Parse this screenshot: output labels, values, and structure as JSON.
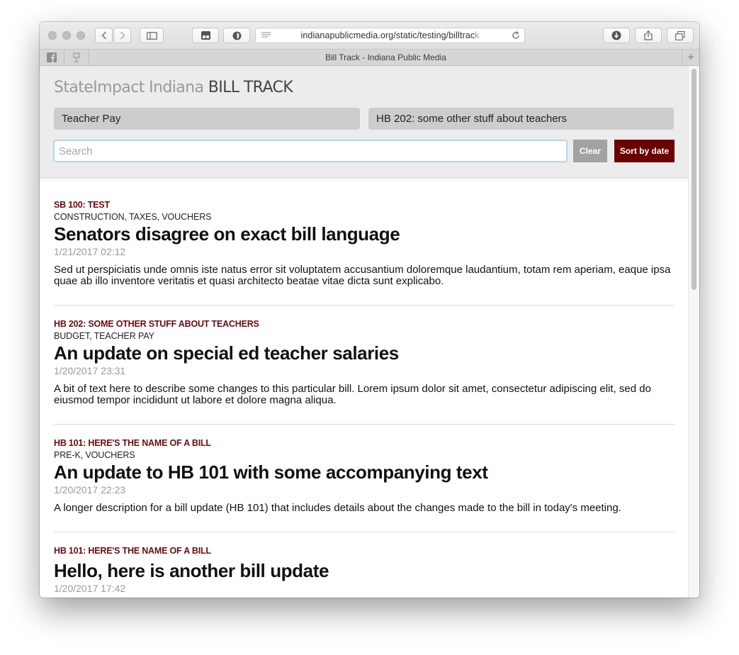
{
  "browser": {
    "url_main": "indianapublicmedia.org/static/testing/billtrac",
    "url_fade": "k",
    "tab_title": "Bill Track - Indiana Public Media",
    "new_tab_symbol": "+"
  },
  "header": {
    "brand_prefix": "StateImpact Indiana",
    "brand_suffix": "BILL TRACK",
    "filter_topic": "Teacher Pay",
    "filter_bill": "HB 202: some other stuff about teachers",
    "search_placeholder": "Search",
    "clear_label": "Clear",
    "sort_label": "Sort by date"
  },
  "entries": [
    {
      "bill": "SB 100: test",
      "tags": "Construction, Taxes, Vouchers",
      "title": "Senators disagree on exact bill language",
      "date": "1/21/2017 02:12",
      "desc": "Sed ut perspiciatis unde omnis iste natus error sit voluptatem accusantium doloremque laudantium, totam rem aperiam, eaque ipsa quae ab illo inventore veritatis et quasi architecto beatae vitae dicta sunt explicabo."
    },
    {
      "bill": "HB 202: some other stuff about teachers",
      "tags": "Budget, Teacher Pay",
      "title": "An update on special ed teacher salaries",
      "date": "1/20/2017 23:31",
      "desc": "A bit of text here to describe some changes to this particular bill. Lorem ipsum dolor sit amet, consectetur adipiscing elit, sed do eiusmod tempor incididunt ut labore et dolore magna aliqua."
    },
    {
      "bill": "HB 101: Here's the name of a bill",
      "tags": "Pre-K, Vouchers",
      "title": "An update to HB 101 with some accompanying text",
      "date": "1/20/2017 22:23",
      "desc": "A longer description for a bill update (HB 101) that includes details about the changes made to the bill in today's meeting."
    },
    {
      "bill": "HB 101: Here's the name of a bill",
      "tags": "",
      "title": "Hello, here is another bill update",
      "date": "1/20/2017 17:42",
      "desc": ""
    }
  ],
  "icons": {
    "back": "chevron-left-icon",
    "forward": "chevron-right-icon",
    "sidebar": "sidebar-icon",
    "reader": "reader-icon",
    "reload": "reload-icon",
    "download": "download-icon",
    "share": "share-icon",
    "tabs": "tabs-overview-icon"
  }
}
